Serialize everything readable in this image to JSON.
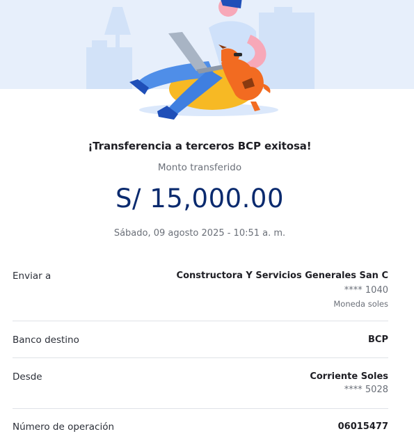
{
  "header": {
    "title": "¡Transferencia a terceros BCP exitosa!",
    "amount_label": "Monto transferido",
    "amount": "S/ 15,000.00",
    "datetime": "Sábado, 09 agosto 2025 - 10:51 a. m."
  },
  "details": {
    "recipient": {
      "label": "Enviar a",
      "name": "Constructora Y Servicios Generales San C",
      "account": "**** 1040",
      "currency": "Moneda soles"
    },
    "bank": {
      "label": "Banco destino",
      "value": "BCP"
    },
    "from": {
      "label": "Desde",
      "account_type": "Corriente Soles",
      "account": "**** 5028"
    },
    "operation": {
      "label": "Número de operación",
      "value": "06015477"
    }
  },
  "colors": {
    "accent_blue": "#0a2a6e",
    "hero_bg": "#e7effb",
    "illustration_orange": "#f26b21",
    "illustration_yellow": "#f7b924",
    "illustration_blue": "#4f8ee8"
  }
}
